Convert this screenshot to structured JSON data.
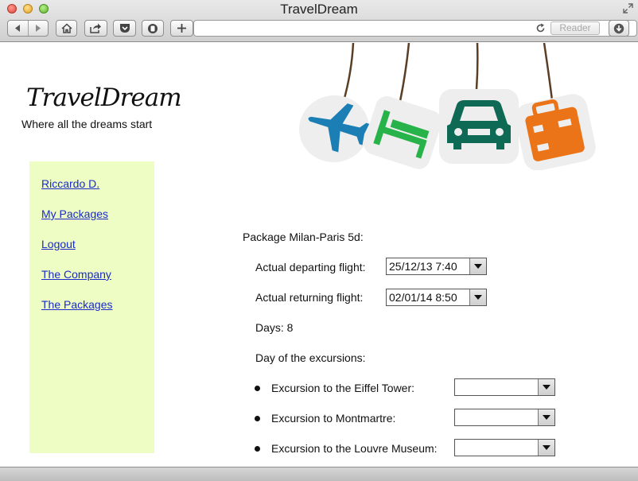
{
  "window": {
    "title": "TravelDream"
  },
  "toolbar": {
    "reader_label": "Reader",
    "url": ""
  },
  "header": {
    "logo_text": "TravelDream",
    "tagline": "Where all the dreams start",
    "banner_tags": [
      "plane-icon",
      "bed-icon",
      "car-icon",
      "suitcase-icon"
    ],
    "banner_colors": {
      "plane": "#1b7fb5",
      "bed": "#27b34a",
      "car": "#0f6a55",
      "suitcase": "#ea7417"
    }
  },
  "sidebar": {
    "background": "#edfdc3",
    "items": [
      {
        "label": "Riccardo D."
      },
      {
        "label": "My Packages"
      },
      {
        "label": "Logout"
      },
      {
        "label": "The Company"
      },
      {
        "label": "The Packages"
      }
    ]
  },
  "main": {
    "package_title": "Package Milan-Paris 5d:",
    "departing_label": "Actual departing flight:",
    "departing_value": "25/12/13 7:40",
    "returning_label": "Actual returning flight:",
    "returning_value": "02/01/14 8:50",
    "days_text": "Days: 8",
    "excursions_heading": "Day of the excursions:",
    "excursions": [
      {
        "label": "Excursion to the Eiffel Tower:",
        "value": ""
      },
      {
        "label": "Excursion to Montmartre:",
        "value": ""
      },
      {
        "label": "Excursion to the Louvre Museum:",
        "value": ""
      }
    ]
  }
}
